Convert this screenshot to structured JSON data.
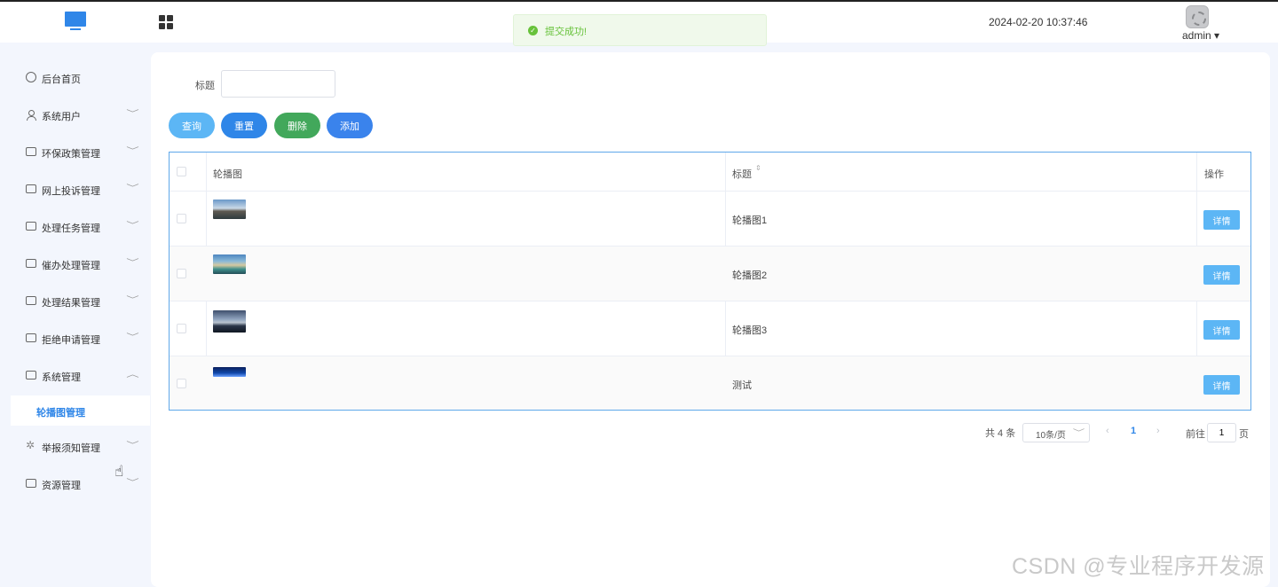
{
  "header": {
    "datetime": "2024-02-20 10:37:46",
    "username": "admin",
    "username_caret": "▾"
  },
  "toast": {
    "message": "提交成功!",
    "icon": "check-circle-icon",
    "color": "#67c23a"
  },
  "sidebar": {
    "items": [
      {
        "label": "后台首页",
        "icon": "clock-icon",
        "arrow": ""
      },
      {
        "label": "系统用户",
        "icon": "user-icon",
        "arrow": "﹀"
      },
      {
        "label": "环保政策管理",
        "icon": "document-icon",
        "arrow": "﹀"
      },
      {
        "label": "网上投诉管理",
        "icon": "document-icon",
        "arrow": "﹀"
      },
      {
        "label": "处理任务管理",
        "icon": "document-icon",
        "arrow": "﹀"
      },
      {
        "label": "催办处理管理",
        "icon": "document-icon",
        "arrow": "﹀"
      },
      {
        "label": "处理结果管理",
        "icon": "document-icon",
        "arrow": "﹀"
      },
      {
        "label": "拒绝申请管理",
        "icon": "document-icon",
        "arrow": "﹀"
      },
      {
        "label": "系统管理",
        "icon": "folder-icon",
        "arrow": "︿"
      },
      {
        "label": "举报须知管理",
        "icon": "sparkle-icon",
        "arrow": "﹀"
      },
      {
        "label": "资源管理",
        "icon": "printer-icon",
        "arrow": "﹀"
      }
    ],
    "active_sub": "轮播图管理"
  },
  "search": {
    "label": "标题",
    "value": "",
    "placeholder": ""
  },
  "toolbar": {
    "query": "查询",
    "reset": "重置",
    "delete": "删除",
    "add": "添加"
  },
  "table": {
    "columns": {
      "image": "轮播图",
      "title": "标题",
      "sort_icon": "⇕",
      "action": "操作"
    },
    "rows": [
      {
        "title": "轮播图1",
        "detail": "详情"
      },
      {
        "title": "轮播图2",
        "detail": "详情"
      },
      {
        "title": "轮播图3",
        "detail": "详情"
      },
      {
        "title": "测试",
        "detail": "详情"
      }
    ]
  },
  "pagination": {
    "total": "共 4 条",
    "page_size": "10条/页",
    "current_page": "1",
    "goto_label": "前往",
    "goto_value": "1",
    "page_suffix": "页"
  },
  "watermark": "CSDN @专业程序开发源",
  "colors": {
    "primary": "#2f86e8",
    "light_blue": "#5cb6f5",
    "green": "#42a85b",
    "success": "#67c23a"
  }
}
